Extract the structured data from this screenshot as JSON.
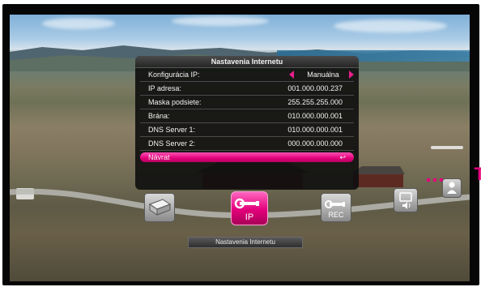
{
  "menu": {
    "title": "Nastavenia Internetu",
    "rows": [
      {
        "label": "Konfigurácia IP:",
        "value": "Manuálna"
      },
      {
        "label": "IP adresa:",
        "value": "001.000.000.237"
      },
      {
        "label": "Maska podsiete:",
        "value": "255.255.255.000"
      },
      {
        "label": "Brána:",
        "value": "010.000.000.001"
      },
      {
        "label": "DNS Server 1:",
        "value": "010.000.000.001"
      },
      {
        "label": "DNS Server 2:",
        "value": "000.000.000.000"
      }
    ],
    "back": {
      "label": "Návrat",
      "return_symbol": "↩"
    }
  },
  "brand": {
    "logo_letter": "T",
    "color": "#e2007a"
  },
  "toolbar": {
    "items": [
      {
        "name": "device-icon",
        "label": ""
      },
      {
        "name": "ip-settings-icon",
        "label": "IP"
      },
      {
        "name": "rec-settings-icon",
        "label": "REC"
      },
      {
        "name": "av-settings-icon",
        "label": ""
      },
      {
        "name": "user-icon",
        "label": ""
      }
    ],
    "selected": "IP"
  },
  "caption": "Nastavenia Internetu"
}
